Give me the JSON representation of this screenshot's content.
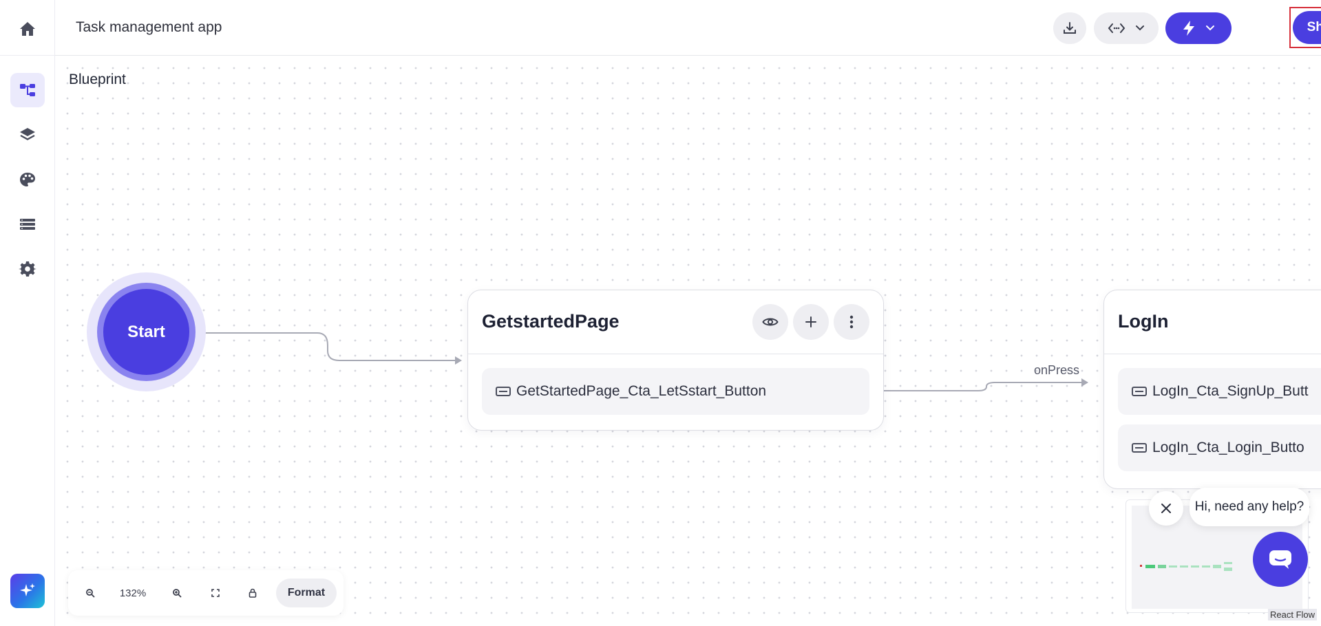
{
  "header": {
    "app_title": "Task management app",
    "share_label": "Share"
  },
  "canvas": {
    "section_title": "Blueprint",
    "start_label": "Start",
    "nodes": [
      {
        "title": "GetstartedPage",
        "rows": [
          "GetStartedPage_Cta_LetSstart_Button"
        ]
      },
      {
        "title": "LogIn",
        "rows": [
          "LogIn_Cta_SignUp_Butt",
          "LogIn_Cta_Login_Butto"
        ]
      }
    ],
    "edge_label": "onPress"
  },
  "controls": {
    "zoom_level": "132%",
    "format_label": "Format"
  },
  "help": {
    "bubble_text": "Hi, need any help?"
  },
  "attribution": "React Flow",
  "colors": {
    "accent": "#4a3ee0",
    "highlight_outline": "#d62f3a"
  },
  "icons": {
    "rail": [
      "home-icon",
      "flow-icon",
      "layers-icon",
      "palette-icon",
      "storage-icon",
      "gear-icon",
      "ai-sparkle-icon"
    ],
    "header": [
      "download-icon",
      "code-icon",
      "chevron-down-icon",
      "bolt-icon"
    ]
  }
}
